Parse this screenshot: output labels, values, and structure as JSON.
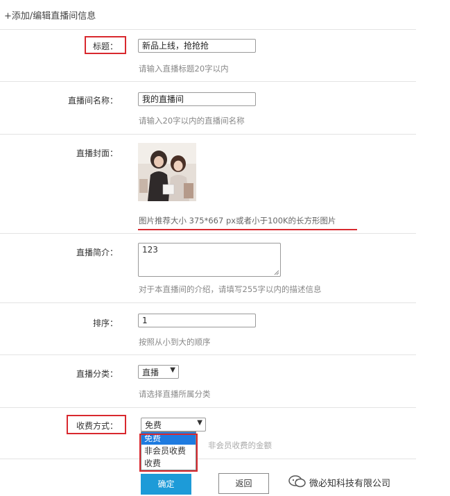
{
  "header": {
    "title": "+添加/编辑直播间信息"
  },
  "fields": {
    "title": {
      "label": "标题：",
      "value": "新品上线，抢抢抢",
      "hint": "请输入直播标题20字以内"
    },
    "room_name": {
      "label": "直播间名称：",
      "value": "我的直播间",
      "hint": "请输入20字以内的直播间名称"
    },
    "cover": {
      "label": "直播封面：",
      "hint": "图片推荐大小 375*667 px或者小于100K的长方形图片"
    },
    "intro": {
      "label": "直播简介：",
      "value": "123",
      "hint": "对于本直播间的介绍，请填写255字以内的描述信息"
    },
    "sort": {
      "label": "排序：",
      "value": "1",
      "hint": "按照从小到大的顺序"
    },
    "category": {
      "label": "直播分类：",
      "value": "直播",
      "hint": "请选择直播所属分类"
    },
    "fee": {
      "label": "收费方式：",
      "value": "免费",
      "hint_partial": "非会员收费的金额",
      "options": [
        "免费",
        "非会员收费",
        "收费"
      ],
      "selected": "免费"
    }
  },
  "buttons": {
    "confirm": "确定",
    "back": "返回"
  },
  "watermark": {
    "text": "微必知科技有限公司"
  },
  "colors": {
    "highlight": "#d8282e",
    "primary_button": "#1d9bd8",
    "selected_option": "#1e7be0"
  }
}
